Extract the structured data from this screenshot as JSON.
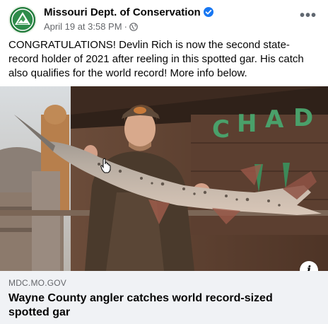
{
  "post": {
    "author": "Missouri Dept. of Conservation",
    "timestamp": "April 19 at 3:58 PM",
    "separator": "·",
    "privacy_icon": "globe-icon",
    "more_label": "•••",
    "caption": "CONGRATULATIONS! Devlin Rich is now the second state-record holder of 2021 after reeling in this spotted gar. His catch also qualifies for the world record! More info below."
  },
  "photo": {
    "sign_letters": [
      "C",
      "H",
      "A",
      "D"
    ],
    "info_label": "i"
  },
  "link_preview": {
    "domain": "MDC.MO.GOV",
    "title": "Wayne County angler catches world record-sized spotted gar"
  },
  "colors": {
    "brand_green": "#1f7a3a",
    "verified_blue": "#1877f2",
    "link_bg": "#f0f2f5",
    "meta_gray": "#65676b"
  }
}
